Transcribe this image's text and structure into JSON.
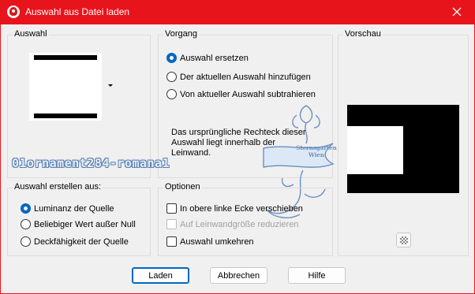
{
  "window": {
    "title": "Auswahl aus Datei laden",
    "accent_color": "#e8141b"
  },
  "auswahl_group": {
    "title": "Auswahl"
  },
  "vorgang_group": {
    "title": "Vorgang",
    "options": [
      {
        "label": "Auswahl ersetzen",
        "checked": true
      },
      {
        "label": "Der aktuellen Auswahl hinzufügen",
        "checked": false
      },
      {
        "label": "Von aktueller Auswahl subtrahieren",
        "checked": false
      }
    ],
    "info_text": "Das ursprüngliche Rechteck dieser Auswahl liegt innerhalb der Leinwand."
  },
  "vorschau_group": {
    "title": "Vorschau"
  },
  "erstellen_group": {
    "title": "Auswahl erstellen aus:",
    "options": [
      {
        "label": "Luminanz der Quelle",
        "checked": true
      },
      {
        "label": "Beliebiger Wert außer Null",
        "checked": false
      },
      {
        "label": "Deckfähigkeit der Quelle",
        "checked": false
      }
    ]
  },
  "optionen_group": {
    "title": "Optionen",
    "checkboxes": [
      {
        "label": "In obere linke Ecke verschieben",
        "checked": false,
        "disabled": false
      },
      {
        "label": "Auf Leinwandgröße reduzieren",
        "checked": false,
        "disabled": true
      },
      {
        "label": "Auswahl umkehren",
        "checked": false,
        "disabled": false
      }
    ]
  },
  "buttons": {
    "load": "Laden",
    "cancel": "Abbrechen",
    "help": "Hilfe"
  },
  "watermark": {
    "text": "01ornament284-romana1",
    "deco_line1": "Sternsgarten",
    "deco_line2": "Wien"
  }
}
